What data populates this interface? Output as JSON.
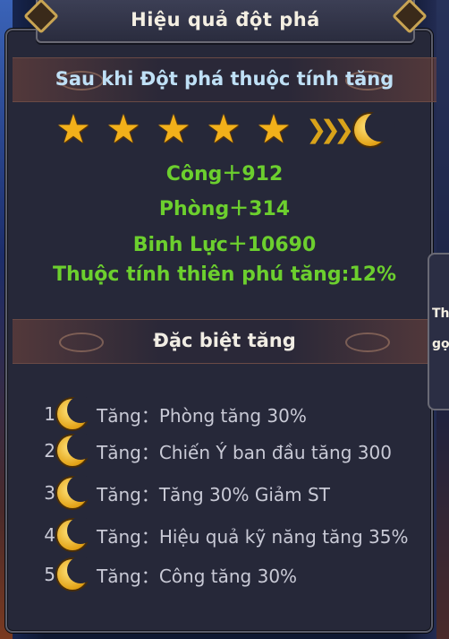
{
  "title": "Hiệu quả đột phá",
  "after_breakthrough": {
    "heading": "Sau khi Đột phá thuộc tính tăng",
    "stars": 5,
    "stats": [
      "Công＋912",
      "Phòng＋314",
      "Binh Lực＋10690",
      "Thuộc tính thiên phú tăng:12%"
    ]
  },
  "special": {
    "heading": "Đặc biệt tăng",
    "items": [
      {
        "num": "1",
        "text": "Tăng：Phòng tăng 30%"
      },
      {
        "num": "2",
        "text": "Tăng：Chiến Ý ban đầu tăng 300"
      },
      {
        "num": "3",
        "text": "Tăng：Tăng 30% Giảm ST"
      },
      {
        "num": "4",
        "text": "Tăng：Hiệu quả kỹ năng tăng 35%"
      },
      {
        "num": "5",
        "text": "Tăng：Công tăng 30%"
      }
    ]
  },
  "side_tab": {
    "line1": "Th",
    "line2": "gọ"
  },
  "colors": {
    "stat_green": "#6ccf2e",
    "heading_blue": "#bfe0f6",
    "star_gold": "#f2b01a"
  }
}
